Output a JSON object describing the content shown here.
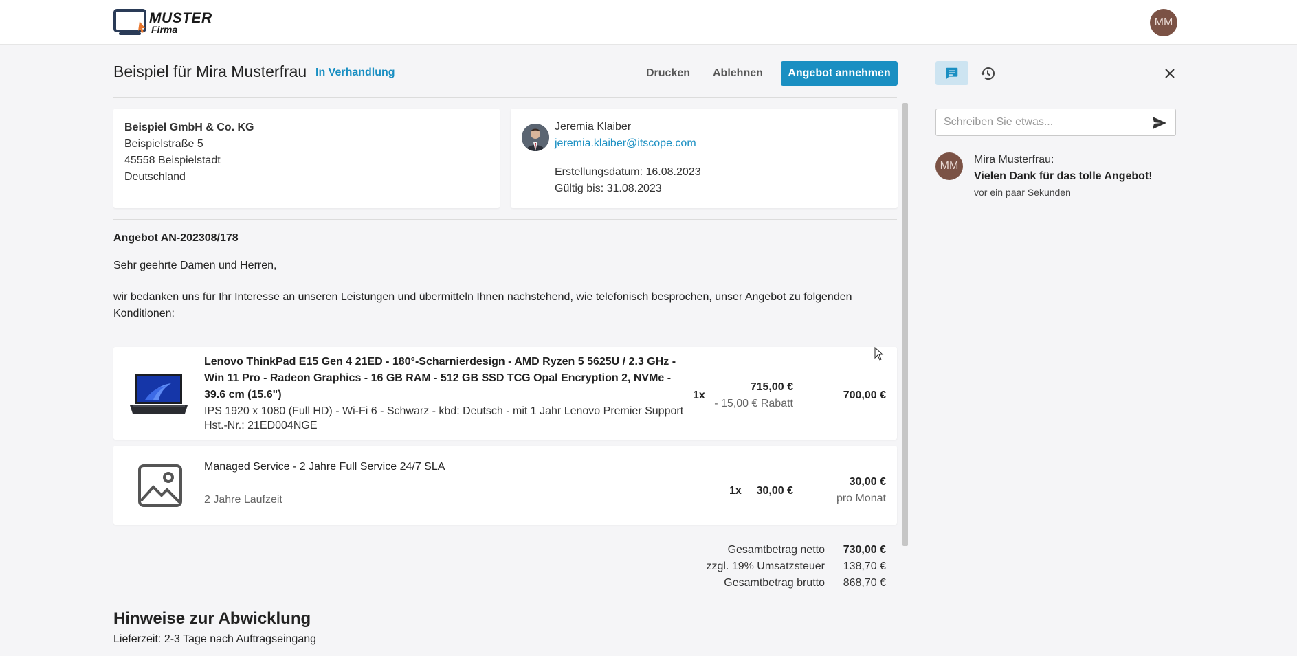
{
  "header": {
    "logo_line1": "MUSTER",
    "logo_line2": "Firma",
    "user_initials": "MM"
  },
  "offer": {
    "title": "Beispiel für Mira Musterfrau",
    "status": "In Verhandlung",
    "actions": {
      "print": "Drucken",
      "reject": "Ablehnen",
      "accept": "Angebot annehmen"
    },
    "address": {
      "company": "Beispiel GmbH & Co. KG",
      "street": "Beispielstraße 5",
      "city": "45558 Beispielstadt",
      "country": "Deutschland"
    },
    "contact": {
      "name": "Jeremia Klaiber",
      "email": "jeremia.klaiber@itscope.com",
      "created": "Erstellungsdatum: 16.08.2023",
      "valid_until": "Gültig bis: 31.08.2023"
    },
    "number": "Angebot AN-202308/178",
    "salutation": "Sehr geehrte Damen und Herren,",
    "intro": "wir bedanken uns für Ihr Interesse an unseren Leistungen und übermitteln Ihnen nachstehend, wie telefonisch besprochen, unser Angebot zu folgenden Konditionen:",
    "items": [
      {
        "title": "Lenovo ThinkPad E15 Gen 4 21ED - 180°-Scharnierdesign - AMD Ryzen 5 5625U / 2.3 GHz - Win 11 Pro - Radeon Graphics - 16 GB RAM - 512 GB SSD TCG Opal Encryption 2, NVMe - 39.6 cm (15.6\")",
        "description": "IPS 1920 x 1080 (Full HD) - Wi-Fi 6 - Schwarz - kbd: Deutsch - mit 1 Jahr Lenovo Premier Support",
        "manufacturer_no": "Hst.-Nr.: 21ED004NGE",
        "quantity": "1x",
        "unit_price": "715,00 €",
        "discount": "- 15,00 € Rabatt",
        "total": "700,00 €"
      },
      {
        "title": "Managed Service - 2 Jahre Full Service 24/7 SLA",
        "runtime": "2 Jahre Laufzeit",
        "quantity": "1x",
        "unit_price": "30,00 €",
        "total": "30,00 €",
        "period": "pro Monat"
      }
    ],
    "totals": {
      "net_label": "Gesamtbetrag netto",
      "net_value": "730,00 €",
      "tax_label": "zzgl. 19% Umsatzsteuer",
      "tax_value": "138,70 €",
      "gross_label": "Gesamtbetrag brutto",
      "gross_value": "868,70 €"
    },
    "hints": {
      "title": "Hinweise zur Abwicklung",
      "delivery": "Lieferzeit: 2-3 Tage nach Auftragseingang"
    }
  },
  "sidebar": {
    "comment_placeholder": "Schreiben Sie etwas...",
    "comments": [
      {
        "initials": "MM",
        "author": "Mira Musterfrau:",
        "text": "Vielen Dank für das tolle Angebot!",
        "time": "vor ein paar Sekunden"
      }
    ]
  },
  "colors": {
    "accent": "#1a8fc2",
    "avatar": "#7b5245",
    "background": "#f5f5f7"
  },
  "icons": [
    "logo-icon",
    "chat-icon",
    "history-icon",
    "close-icon",
    "send-icon",
    "image-placeholder-icon",
    "laptop-image"
  ]
}
